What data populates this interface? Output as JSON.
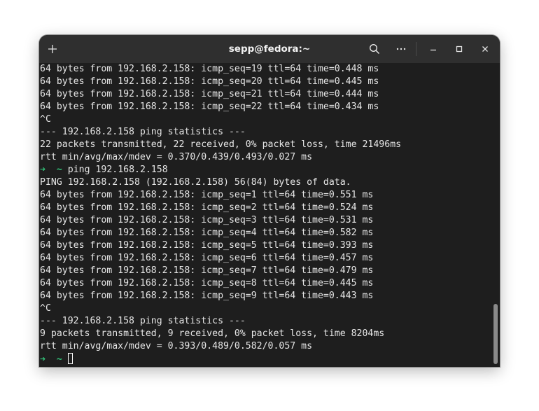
{
  "window": {
    "title": "sepp@fedora:~",
    "icons": {
      "new_tab": "plus-icon",
      "search": "search-icon",
      "menu": "ellipsis-icon",
      "minimize": "minimize-icon",
      "maximize": "maximize-icon",
      "close": "close-icon"
    }
  },
  "terminal": {
    "prompt_symbol": "➜",
    "prompt_dir": "~",
    "lines": [
      {
        "type": "out",
        "text": "64 bytes from 192.168.2.158: icmp_seq=19 ttl=64 time=0.448 ms"
      },
      {
        "type": "out",
        "text": "64 bytes from 192.168.2.158: icmp_seq=20 ttl=64 time=0.445 ms"
      },
      {
        "type": "out",
        "text": "64 bytes from 192.168.2.158: icmp_seq=21 ttl=64 time=0.444 ms"
      },
      {
        "type": "out",
        "text": "64 bytes from 192.168.2.158: icmp_seq=22 ttl=64 time=0.434 ms"
      },
      {
        "type": "out",
        "text": "^C"
      },
      {
        "type": "out",
        "text": "--- 192.168.2.158 ping statistics ---"
      },
      {
        "type": "out",
        "text": "22 packets transmitted, 22 received, 0% packet loss, time 21496ms"
      },
      {
        "type": "out",
        "text": "rtt min/avg/max/mdev = 0.370/0.439/0.493/0.027 ms"
      },
      {
        "type": "prompt",
        "text": "ping 192.168.2.158"
      },
      {
        "type": "out",
        "text": "PING 192.168.2.158 (192.168.2.158) 56(84) bytes of data."
      },
      {
        "type": "out",
        "text": "64 bytes from 192.168.2.158: icmp_seq=1 ttl=64 time=0.551 ms"
      },
      {
        "type": "out",
        "text": "64 bytes from 192.168.2.158: icmp_seq=2 ttl=64 time=0.524 ms"
      },
      {
        "type": "out",
        "text": "64 bytes from 192.168.2.158: icmp_seq=3 ttl=64 time=0.531 ms"
      },
      {
        "type": "out",
        "text": "64 bytes from 192.168.2.158: icmp_seq=4 ttl=64 time=0.582 ms"
      },
      {
        "type": "out",
        "text": "64 bytes from 192.168.2.158: icmp_seq=5 ttl=64 time=0.393 ms"
      },
      {
        "type": "out",
        "text": "64 bytes from 192.168.2.158: icmp_seq=6 ttl=64 time=0.457 ms"
      },
      {
        "type": "out",
        "text": "64 bytes from 192.168.2.158: icmp_seq=7 ttl=64 time=0.479 ms"
      },
      {
        "type": "out",
        "text": "64 bytes from 192.168.2.158: icmp_seq=8 ttl=64 time=0.445 ms"
      },
      {
        "type": "out",
        "text": "64 bytes from 192.168.2.158: icmp_seq=9 ttl=64 time=0.443 ms"
      },
      {
        "type": "out",
        "text": "^C"
      },
      {
        "type": "out",
        "text": "--- 192.168.2.158 ping statistics ---"
      },
      {
        "type": "out",
        "text": "9 packets transmitted, 9 received, 0% packet loss, time 8204ms"
      },
      {
        "type": "out",
        "text": "rtt min/avg/max/mdev = 0.393/0.489/0.582/0.057 ms"
      },
      {
        "type": "input",
        "text": ""
      }
    ]
  },
  "colors": {
    "background": "#1e1e1e",
    "titlebar": "#2f2f2f",
    "text": "#e6e6e6",
    "prompt": "#33c47a"
  }
}
